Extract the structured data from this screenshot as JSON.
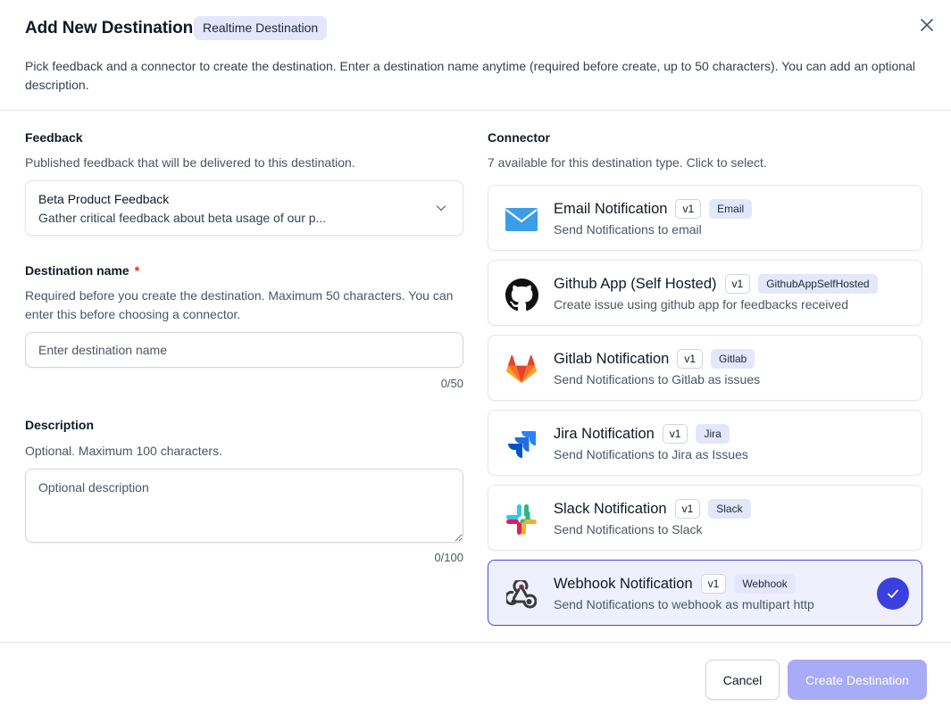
{
  "modal": {
    "title": "Add New Destination",
    "badge": "Realtime Destination",
    "subtitle": "Pick feedback and a connector to create the destination. Enter a destination name anytime (required before create, up to 50 characters). You can add an optional description."
  },
  "feedback": {
    "label": "Feedback",
    "help": "Published feedback that will be delivered to this destination.",
    "selected_title": "Beta Product Feedback",
    "selected_desc": "Gather critical feedback about beta usage of our p..."
  },
  "destination_name": {
    "label": "Destination name",
    "required_mark": "*",
    "help": "Required before you create the destination. Maximum 50 characters. You can enter this before choosing a connector.",
    "placeholder": "Enter destination name",
    "value": "",
    "counter": "0/50"
  },
  "description": {
    "label": "Description",
    "help": "Optional. Maximum 100 characters.",
    "placeholder": "Optional description",
    "counter": "0/100"
  },
  "connector": {
    "label": "Connector",
    "help": "7 available for this destination type. Click to select.",
    "items": [
      {
        "name": "Email Notification",
        "version": "v1",
        "tag": "Email",
        "desc": "Send Notifications to email",
        "icon": "email-icon"
      },
      {
        "name": "Github App (Self Hosted)",
        "version": "v1",
        "tag": "GithubAppSelfHosted",
        "desc": "Create issue using github app for feedbacks received",
        "icon": "github-icon"
      },
      {
        "name": "Gitlab Notification",
        "version": "v1",
        "tag": "Gitlab",
        "desc": "Send Notifications to Gitlab as issues",
        "icon": "gitlab-icon"
      },
      {
        "name": "Jira Notification",
        "version": "v1",
        "tag": "Jira",
        "desc": "Send Notifications to Jira as Issues",
        "icon": "jira-icon"
      },
      {
        "name": "Slack Notification",
        "version": "v1",
        "tag": "Slack",
        "desc": "Send Notifications to Slack",
        "icon": "slack-icon"
      },
      {
        "name": "Webhook Notification",
        "version": "v1",
        "tag": "Webhook",
        "desc": "Send Notifications to webhook as multipart http",
        "icon": "webhook-icon",
        "selected": true
      }
    ]
  },
  "footer": {
    "cancel_label": "Cancel",
    "create_label": "Create Destination"
  },
  "colors": {
    "accent": "#3b3fe0",
    "badge_bg": "#e4e6fb",
    "create_disabled": "#a8abf6",
    "required": "#dc2626"
  }
}
